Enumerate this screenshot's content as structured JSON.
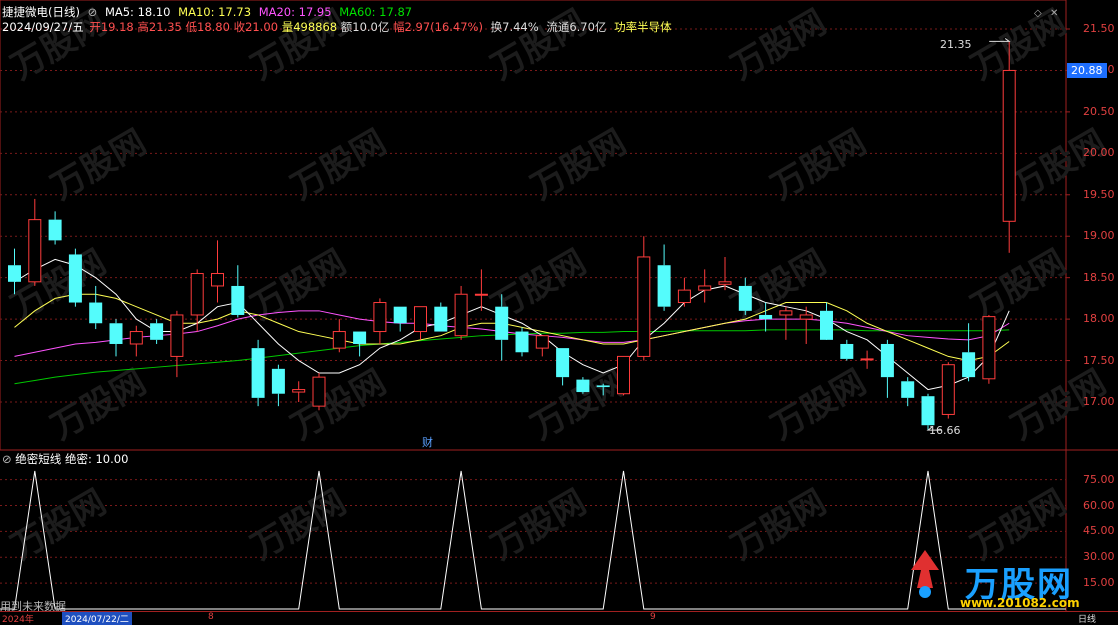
{
  "header": {
    "title": "捷捷微电(日线)",
    "ma5": "MA5: 18.10",
    "ma10": "MA10: 17.73",
    "ma20": "MA20: 17.95",
    "ma60": "MA60: 17.87",
    "date": "2024/09/27/五",
    "open": "开19.18",
    "high": "高21.35",
    "low": "低18.80",
    "close": "收21.00",
    "volume": "量498868",
    "amount": "额10.0亿",
    "change": "幅2.97(16.47%)",
    "turnover": "换7.44%",
    "float": "流通6.70亿",
    "sector": "功率半导体"
  },
  "price_axis": [
    "21.50",
    "21.00",
    "20.50",
    "20.00",
    "19.50",
    "19.00",
    "18.50",
    "18.00",
    "17.50",
    "17.00"
  ],
  "current_price": "20.88",
  "annotations": {
    "high": "21.35",
    "low": "16.66",
    "marker": "财"
  },
  "indicator": {
    "title": "绝密短线",
    "value": "绝密: 10.00",
    "axis": [
      "75.00",
      "60.00",
      "45.00",
      "30.00",
      "15.00"
    ]
  },
  "footer": {
    "left_text": "用到未来数据",
    "year": "2024年",
    "date_box": "2024/07/22/二",
    "tick_a": "8",
    "tick_b": "9",
    "period": "日线"
  },
  "watermark": {
    "brand": "万股网",
    "url": "www.201082.com"
  },
  "colors": {
    "up": "#ff3c3c",
    "down": "#54fcfc",
    "ma5": "#ffffff",
    "ma10": "#ffff54",
    "ma20": "#ff54ff",
    "ma60": "#00c800"
  },
  "chart_data": {
    "type": "candlestick",
    "ylim": [
      16.5,
      21.6
    ],
    "candles": [
      {
        "o": 18.65,
        "h": 18.85,
        "l": 18.3,
        "c": 18.45
      },
      {
        "o": 18.45,
        "h": 19.45,
        "l": 18.4,
        "c": 19.2
      },
      {
        "o": 19.2,
        "h": 19.3,
        "l": 18.9,
        "c": 18.95
      },
      {
        "o": 18.78,
        "h": 18.85,
        "l": 18.15,
        "c": 18.2
      },
      {
        "o": 18.2,
        "h": 18.4,
        "l": 17.88,
        "c": 17.95
      },
      {
        "o": 17.95,
        "h": 18.0,
        "l": 17.55,
        "c": 17.7
      },
      {
        "o": 17.7,
        "h": 17.92,
        "l": 17.55,
        "c": 17.85
      },
      {
        "o": 17.95,
        "h": 18.0,
        "l": 17.7,
        "c": 17.75
      },
      {
        "o": 17.55,
        "h": 18.1,
        "l": 17.3,
        "c": 18.05
      },
      {
        "o": 18.05,
        "h": 18.6,
        "l": 17.85,
        "c": 18.55
      },
      {
        "o": 18.4,
        "h": 18.95,
        "l": 18.2,
        "c": 18.55
      },
      {
        "o": 18.4,
        "h": 18.65,
        "l": 18.02,
        "c": 18.05
      },
      {
        "o": 17.65,
        "h": 17.75,
        "l": 16.95,
        "c": 17.05
      },
      {
        "o": 17.4,
        "h": 17.45,
        "l": 16.95,
        "c": 17.1
      },
      {
        "o": 17.12,
        "h": 17.25,
        "l": 17.0,
        "c": 17.15
      },
      {
        "o": 16.95,
        "h": 17.35,
        "l": 16.9,
        "c": 17.3
      },
      {
        "o": 17.65,
        "h": 18.0,
        "l": 17.6,
        "c": 17.85
      },
      {
        "o": 17.85,
        "h": 17.85,
        "l": 17.55,
        "c": 17.7
      },
      {
        "o": 17.85,
        "h": 18.25,
        "l": 17.7,
        "c": 18.2
      },
      {
        "o": 18.15,
        "h": 18.15,
        "l": 17.85,
        "c": 17.95
      },
      {
        "o": 17.85,
        "h": 18.15,
        "l": 17.75,
        "c": 18.15
      },
      {
        "o": 18.15,
        "h": 18.2,
        "l": 17.85,
        "c": 17.85
      },
      {
        "o": 17.8,
        "h": 18.4,
        "l": 17.75,
        "c": 18.3
      },
      {
        "o": 18.3,
        "h": 18.6,
        "l": 18.1,
        "c": 18.3
      },
      {
        "o": 18.15,
        "h": 18.3,
        "l": 17.5,
        "c": 17.75
      },
      {
        "o": 17.85,
        "h": 17.9,
        "l": 17.55,
        "c": 17.6
      },
      {
        "o": 17.65,
        "h": 17.8,
        "l": 17.55,
        "c": 17.8
      },
      {
        "o": 17.65,
        "h": 17.65,
        "l": 17.2,
        "c": 17.3
      },
      {
        "o": 17.27,
        "h": 17.3,
        "l": 17.1,
        "c": 17.12
      },
      {
        "o": 17.2,
        "h": 17.22,
        "l": 17.08,
        "c": 17.18
      },
      {
        "o": 17.1,
        "h": 17.55,
        "l": 17.08,
        "c": 17.55
      },
      {
        "o": 17.55,
        "h": 19.0,
        "l": 17.5,
        "c": 18.75
      },
      {
        "o": 18.65,
        "h": 18.9,
        "l": 18.1,
        "c": 18.15
      },
      {
        "o": 18.2,
        "h": 18.5,
        "l": 18.15,
        "c": 18.35
      },
      {
        "o": 18.35,
        "h": 18.6,
        "l": 18.2,
        "c": 18.4
      },
      {
        "o": 18.42,
        "h": 18.75,
        "l": 18.35,
        "c": 18.45
      },
      {
        "o": 18.4,
        "h": 18.5,
        "l": 18.05,
        "c": 18.1
      },
      {
        "o": 18.05,
        "h": 18.2,
        "l": 17.85,
        "c": 18.0
      },
      {
        "o": 18.05,
        "h": 18.15,
        "l": 17.75,
        "c": 18.1
      },
      {
        "o": 18.0,
        "h": 18.15,
        "l": 17.7,
        "c": 18.05
      },
      {
        "o": 18.1,
        "h": 18.2,
        "l": 17.8,
        "c": 17.75
      },
      {
        "o": 17.7,
        "h": 17.75,
        "l": 17.5,
        "c": 17.52
      },
      {
        "o": 17.52,
        "h": 17.62,
        "l": 17.4,
        "c": 17.52
      },
      {
        "o": 17.7,
        "h": 17.75,
        "l": 17.05,
        "c": 17.3
      },
      {
        "o": 17.25,
        "h": 17.3,
        "l": 16.95,
        "c": 17.05
      },
      {
        "o": 17.07,
        "h": 17.1,
        "l": 16.66,
        "c": 16.72
      },
      {
        "o": 16.85,
        "h": 17.48,
        "l": 16.8,
        "c": 17.45
      },
      {
        "o": 17.6,
        "h": 17.95,
        "l": 17.25,
        "c": 17.3
      },
      {
        "o": 17.28,
        "h": 18.05,
        "l": 17.22,
        "c": 18.03
      },
      {
        "o": 19.18,
        "h": 21.35,
        "l": 18.8,
        "c": 21.0
      }
    ],
    "ma5": [
      18.45,
      18.6,
      18.72,
      18.65,
      18.5,
      18.3,
      18.0,
      17.85,
      17.85,
      17.95,
      18.15,
      18.2,
      17.95,
      17.7,
      17.5,
      17.35,
      17.35,
      17.45,
      17.65,
      17.75,
      17.9,
      17.95,
      18.05,
      18.15,
      18.05,
      17.95,
      17.8,
      17.6,
      17.45,
      17.35,
      17.45,
      17.75,
      17.95,
      18.2,
      18.35,
      18.4,
      18.3,
      18.2,
      18.15,
      18.1,
      18.0,
      17.85,
      17.75,
      17.55,
      17.35,
      17.15,
      17.2,
      17.3,
      17.55,
      18.1
    ],
    "ma10": [
      17.9,
      18.1,
      18.25,
      18.3,
      18.3,
      18.25,
      18.15,
      18.05,
      17.95,
      17.95,
      18.0,
      18.1,
      18.05,
      17.95,
      17.85,
      17.8,
      17.75,
      17.7,
      17.7,
      17.7,
      17.75,
      17.8,
      17.9,
      17.95,
      17.95,
      17.9,
      17.85,
      17.8,
      17.75,
      17.7,
      17.7,
      17.75,
      17.8,
      17.85,
      17.9,
      17.95,
      18.0,
      18.1,
      18.2,
      18.2,
      18.2,
      18.1,
      17.95,
      17.85,
      17.75,
      17.65,
      17.55,
      17.5,
      17.55,
      17.73
    ],
    "ma20": [
      17.55,
      17.6,
      17.65,
      17.7,
      17.72,
      17.75,
      17.78,
      17.8,
      17.82,
      17.85,
      17.92,
      18.0,
      18.05,
      18.08,
      18.1,
      18.1,
      18.05,
      18.0,
      17.97,
      17.95,
      17.95,
      17.92,
      17.9,
      17.88,
      17.85,
      17.82,
      17.8,
      17.78,
      17.75,
      17.72,
      17.72,
      17.75,
      17.8,
      17.85,
      17.9,
      17.95,
      17.98,
      18.0,
      18.0,
      18.0,
      17.98,
      17.95,
      17.9,
      17.85,
      17.8,
      17.78,
      17.76,
      17.75,
      17.8,
      17.95
    ],
    "ma60": [
      17.22,
      17.26,
      17.3,
      17.33,
      17.36,
      17.38,
      17.4,
      17.42,
      17.44,
      17.46,
      17.48,
      17.5,
      17.53,
      17.56,
      17.59,
      17.62,
      17.65,
      17.68,
      17.7,
      17.72,
      17.74,
      17.76,
      17.78,
      17.8,
      17.81,
      17.82,
      17.83,
      17.83,
      17.84,
      17.84,
      17.85,
      17.85,
      17.85,
      17.86,
      17.86,
      17.86,
      17.86,
      17.87,
      17.87,
      17.87,
      17.87,
      17.87,
      17.86,
      17.86,
      17.86,
      17.86,
      17.86,
      17.86,
      17.86,
      17.87
    ],
    "indicator": {
      "name": "绝密",
      "ylim": [
        0,
        90
      ],
      "values": [
        0,
        80,
        0,
        0,
        0,
        0,
        0,
        0,
        0,
        0,
        0,
        0,
        0,
        0,
        0,
        80,
        0,
        0,
        0,
        0,
        0,
        0,
        80,
        0,
        0,
        0,
        0,
        0,
        0,
        0,
        80,
        0,
        0,
        0,
        0,
        0,
        0,
        0,
        0,
        0,
        0,
        0,
        0,
        0,
        0,
        80,
        0,
        0,
        0,
        0
      ]
    }
  }
}
